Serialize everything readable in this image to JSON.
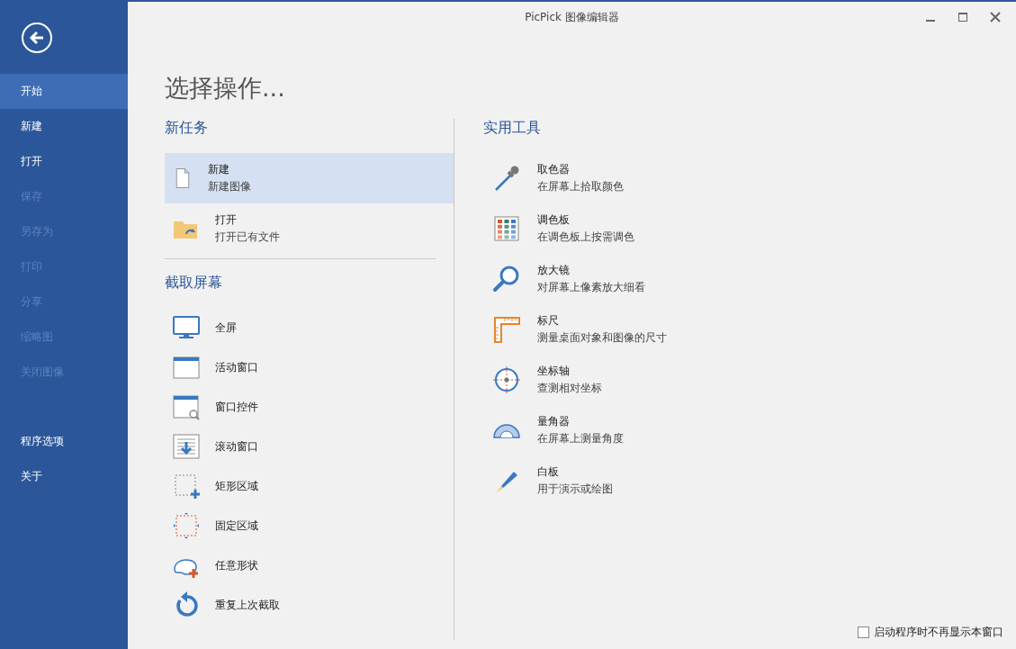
{
  "window": {
    "title": "PicPick 图像编辑器"
  },
  "sidebar": {
    "items": [
      {
        "label": "开始",
        "selected": true,
        "disabled": false
      },
      {
        "label": "新建",
        "selected": false,
        "disabled": false
      },
      {
        "label": "打开",
        "selected": false,
        "disabled": false
      },
      {
        "label": "保存",
        "selected": false,
        "disabled": true
      },
      {
        "label": "另存为",
        "selected": false,
        "disabled": true
      },
      {
        "label": "打印",
        "selected": false,
        "disabled": true
      },
      {
        "label": "分享",
        "selected": false,
        "disabled": true
      },
      {
        "label": "缩略图",
        "selected": false,
        "disabled": true
      },
      {
        "label": "关闭图像",
        "selected": false,
        "disabled": true
      }
    ],
    "bottom_items": [
      {
        "label": "程序选项",
        "selected": false,
        "disabled": false
      },
      {
        "label": "关于",
        "selected": false,
        "disabled": false
      }
    ]
  },
  "heading": "选择操作...",
  "new_task": {
    "title": "新任务",
    "items": [
      {
        "label": "新建",
        "description": "新建图像",
        "selected": true
      },
      {
        "label": "打开",
        "description": "打开已有文件",
        "selected": false
      }
    ]
  },
  "capture": {
    "title": "截取屏幕",
    "items": [
      {
        "label": "全屏"
      },
      {
        "label": "活动窗口"
      },
      {
        "label": "窗口控件"
      },
      {
        "label": "滚动窗口"
      },
      {
        "label": "矩形区域"
      },
      {
        "label": "固定区域"
      },
      {
        "label": "任意形状"
      },
      {
        "label": "重复上次截取"
      }
    ]
  },
  "tools": {
    "title": "实用工具",
    "items": [
      {
        "label": "取色器",
        "description": "在屏幕上拾取颜色"
      },
      {
        "label": "调色板",
        "description": "在调色板上按需调色"
      },
      {
        "label": "放大镜",
        "description": "对屏幕上像素放大细看"
      },
      {
        "label": "标尺",
        "description": "测量桌面对象和图像的尺寸"
      },
      {
        "label": "坐标轴",
        "description": "查测相对坐标"
      },
      {
        "label": "量角器",
        "description": "在屏幕上测量角度"
      },
      {
        "label": "白板",
        "description": "用于演示或绘图"
      }
    ]
  },
  "footer": {
    "label": "启动程序时不再显示本窗口",
    "checked": false
  }
}
